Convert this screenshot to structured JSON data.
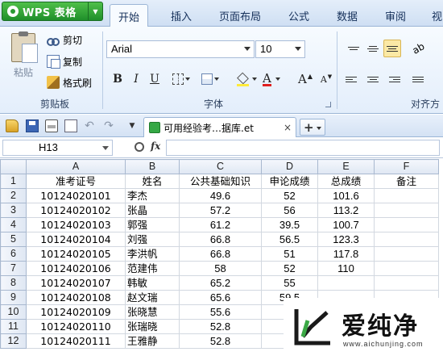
{
  "app": {
    "menu_label": "WPS 表格",
    "tabs": [
      "开始",
      "插入",
      "页面布局",
      "公式",
      "数据",
      "审阅",
      "视"
    ]
  },
  "ribbon": {
    "clipboard": {
      "paste": "粘贴",
      "cut": "剪切",
      "copy": "复制",
      "format_painter": "格式刷",
      "group_label": "剪贴板"
    },
    "font": {
      "family": "Arial",
      "size": "10",
      "bold": "B",
      "italic": "I",
      "underline": "U",
      "font_color_glyph": "A",
      "grow": "A",
      "shrink": "A",
      "group_label": "字体"
    },
    "align": {
      "group_label": "对齐方"
    }
  },
  "quick_access": {
    "doc_tab": "可用经验考…据库.et",
    "close": "×",
    "new_tab": "+"
  },
  "formula_bar": {
    "name_box": "H13",
    "fx": "fx",
    "value": ""
  },
  "sheet": {
    "columns": [
      "A",
      "B",
      "C",
      "D",
      "E",
      "F"
    ],
    "headers": [
      "准考证号",
      "姓名",
      "公共基础知识",
      "申论成绩",
      "总成绩",
      "备注"
    ],
    "rows": [
      [
        "10124020101",
        "李杰",
        "49.6",
        "52",
        "101.6",
        ""
      ],
      [
        "10124020102",
        "张晶",
        "57.2",
        "56",
        "113.2",
        ""
      ],
      [
        "10124020103",
        "郭强",
        "61.2",
        "39.5",
        "100.7",
        ""
      ],
      [
        "10124020104",
        "刘强",
        "66.8",
        "56.5",
        "123.3",
        ""
      ],
      [
        "10124020105",
        "李洪帆",
        "66.8",
        "51",
        "117.8",
        ""
      ],
      [
        "10124020106",
        "范建伟",
        "58",
        "52",
        "110",
        ""
      ],
      [
        "10124020107",
        "韩敏",
        "65.2",
        "55",
        "",
        ""
      ],
      [
        "10124020108",
        "赵文瑞",
        "65.6",
        "59.5",
        "",
        ""
      ],
      [
        "10124020109",
        "张晓慧",
        "55.6",
        "",
        "",
        ""
      ],
      [
        "10124020110",
        "张瑞晓",
        "52.8",
        "",
        "",
        ""
      ],
      [
        "10124020111",
        "王雅静",
        "52.8",
        "",
        "",
        ""
      ]
    ]
  },
  "watermark": {
    "brand": "爱纯净",
    "url": "www.aichunjing.com"
  }
}
